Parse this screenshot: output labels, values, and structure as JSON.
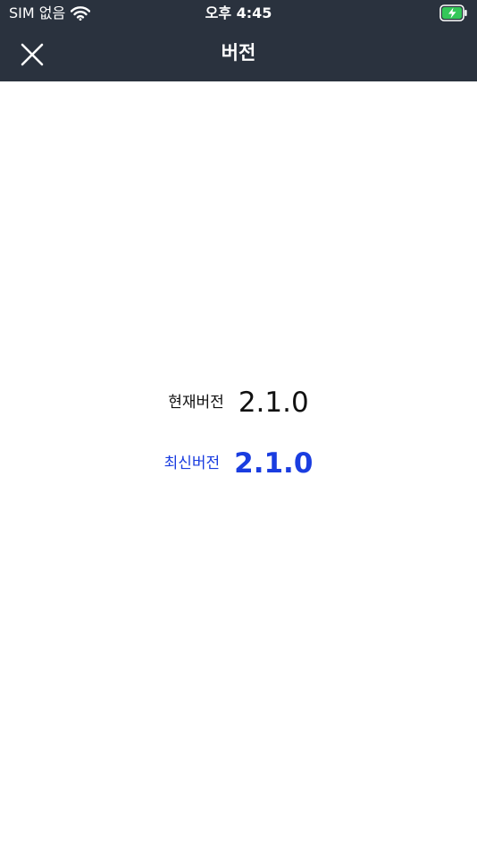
{
  "status_bar": {
    "carrier": "SIM 없음",
    "time": "오후 4:45",
    "wifi_icon": "wifi-icon",
    "battery_icon": "battery-charging-icon"
  },
  "nav": {
    "title": "버전",
    "close_icon": "close-icon"
  },
  "versions": {
    "current_label": "현재버전",
    "current_value": "2.1.0",
    "latest_label": "최신버전",
    "latest_value": "2.1.0"
  },
  "colors": {
    "nav_background": "#2a323e",
    "latest_accent": "#1a3de0",
    "battery_fill": "#34c759"
  }
}
